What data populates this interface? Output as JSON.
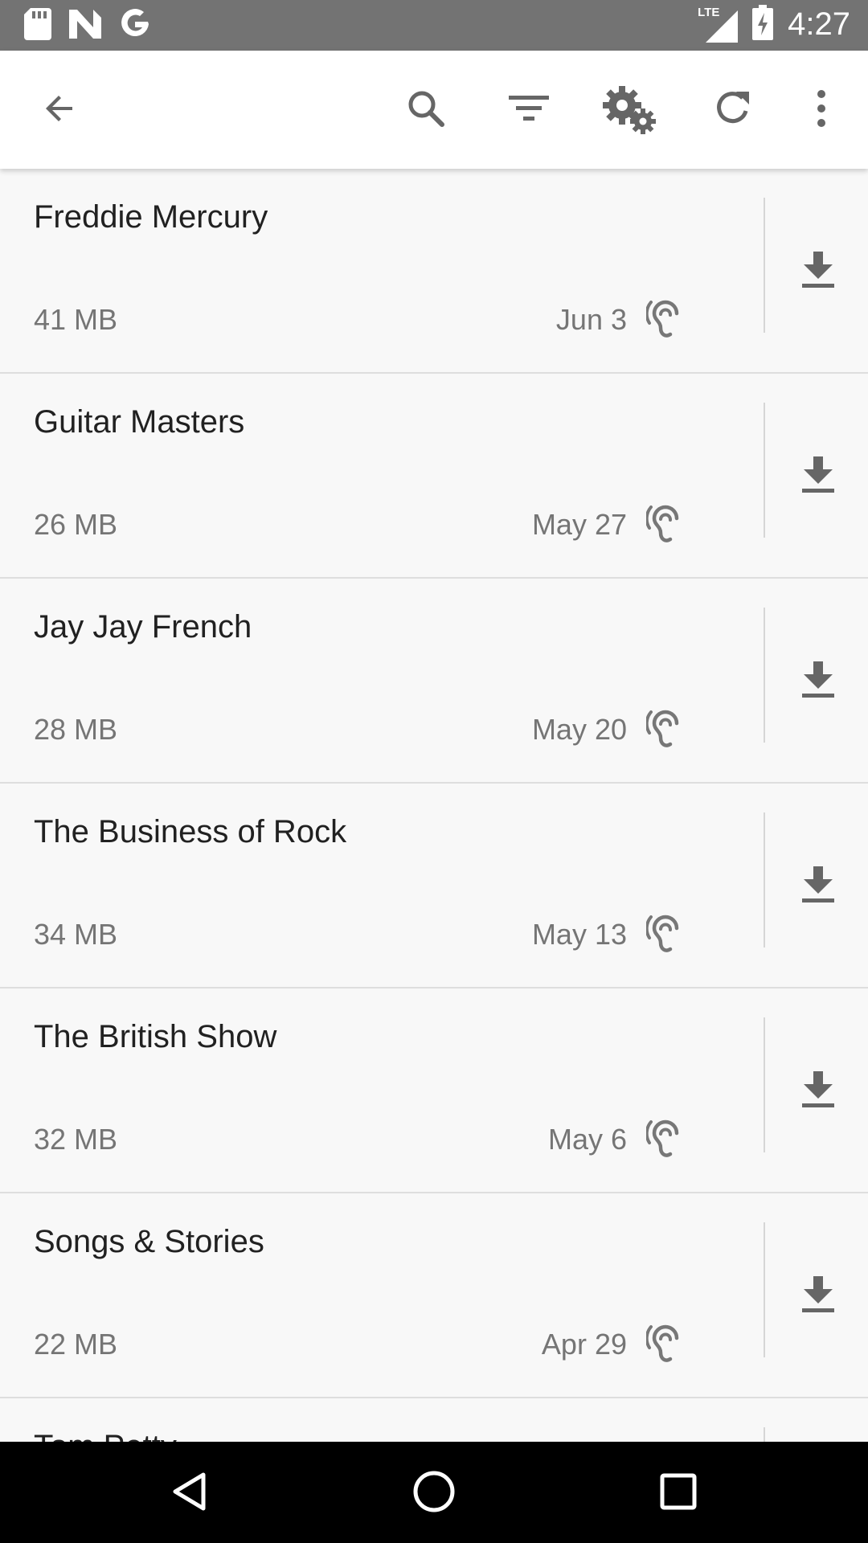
{
  "status_bar": {
    "time": "4:27",
    "network_label": "LTE",
    "left_icons": [
      "sd-card-icon",
      "n-notification-icon",
      "google-icon"
    ],
    "right_icons": [
      "lte-signal-icon",
      "battery-charging-icon"
    ]
  },
  "toolbar": {
    "icons": [
      "back-arrow-icon",
      "search-icon",
      "filter-icon",
      "settings-gears-icon",
      "refresh-icon",
      "more-vert-icon"
    ]
  },
  "episodes": [
    {
      "title": "Freddie Mercury",
      "size": "41 MB",
      "date": "Jun 3"
    },
    {
      "title": "Guitar Masters",
      "size": "26 MB",
      "date": "May 27"
    },
    {
      "title": "Jay Jay French",
      "size": "28 MB",
      "date": "May 20"
    },
    {
      "title": "The Business of Rock",
      "size": "34 MB",
      "date": "May 13"
    },
    {
      "title": "The British Show",
      "size": "32 MB",
      "date": "May 6"
    },
    {
      "title": "Songs & Stories",
      "size": "22 MB",
      "date": "Apr 29"
    },
    {
      "title": "Tom Petty",
      "size": "",
      "date": ""
    }
  ],
  "nav_bar": {
    "icons": [
      "back-triangle-icon",
      "home-circle-icon",
      "recents-square-icon"
    ]
  },
  "colors": {
    "status_bar": "#737373",
    "toolbar": "#ffffff",
    "list_background": "#f8f8f8",
    "icon_gray": "#666666",
    "nav_bar": "#000000"
  }
}
